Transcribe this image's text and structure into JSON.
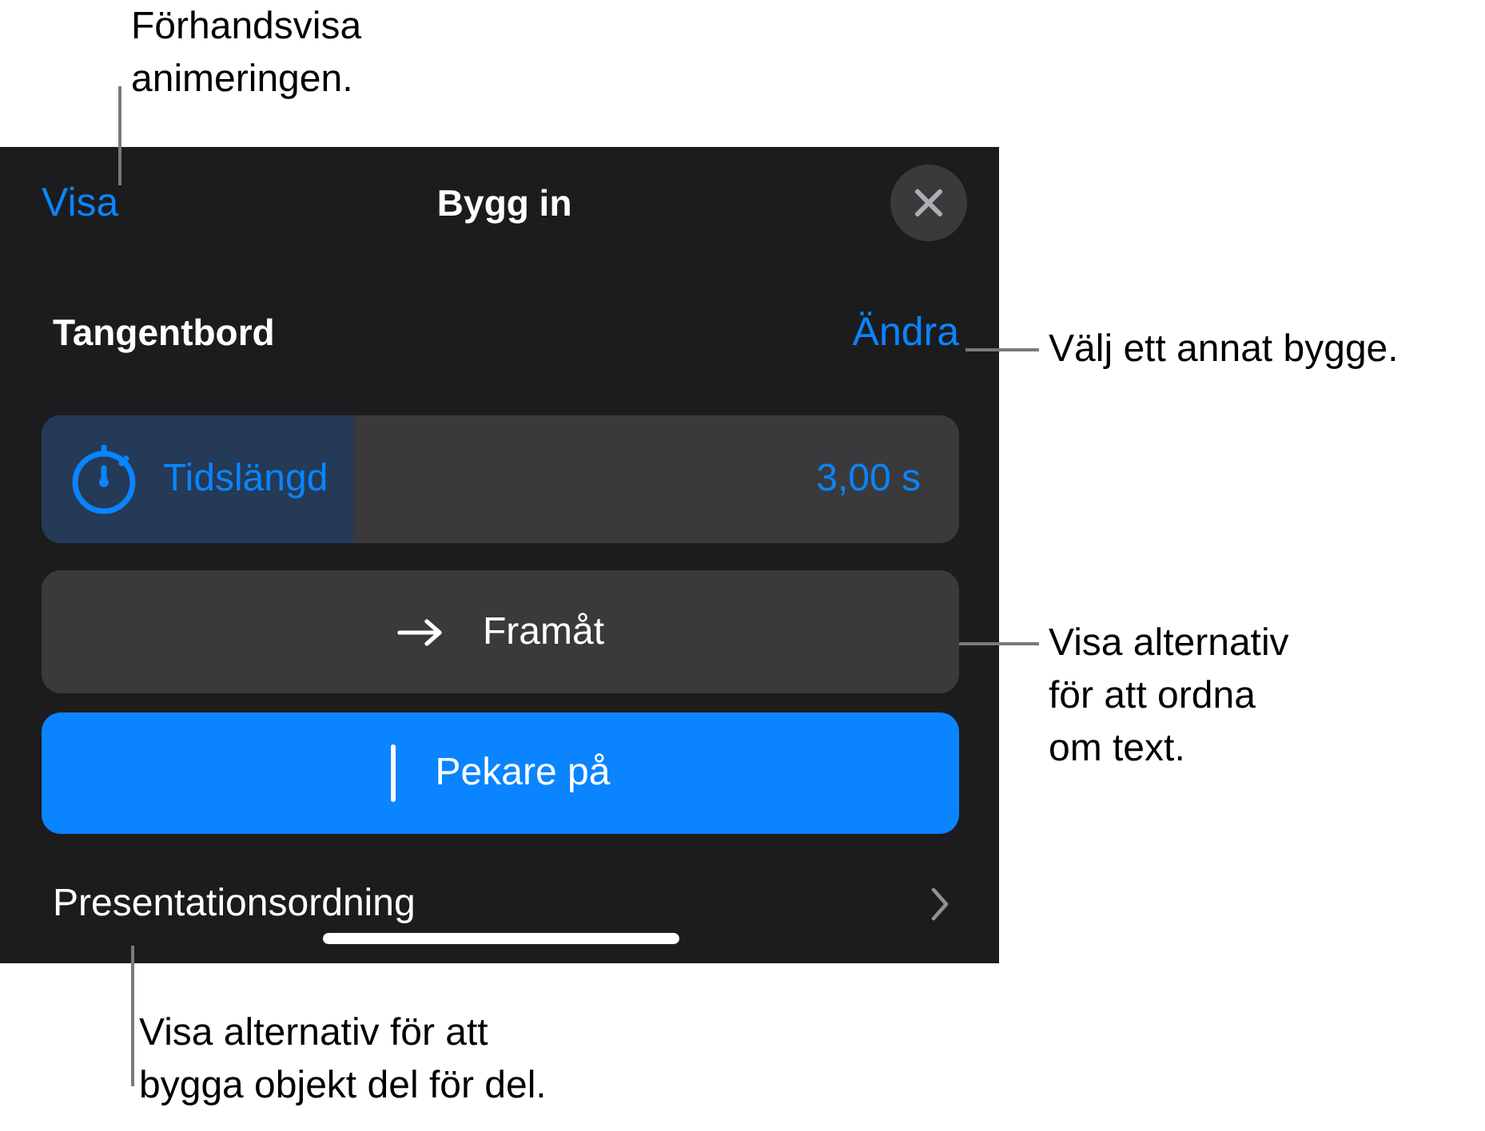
{
  "panel": {
    "preview_link": "Visa",
    "title": "Bygg in",
    "effect": {
      "name": "Tangentbord",
      "change_link": "Ändra"
    },
    "duration": {
      "label": "Tidslängd",
      "value": "3,00 s",
      "level": 0.34
    },
    "buttons": [
      {
        "label": "Framåt",
        "kind": "direction",
        "on": false
      },
      {
        "label": "Pekare på",
        "kind": "cursor",
        "on": true
      }
    ],
    "order_row": {
      "label": "Presentationsordning"
    }
  },
  "callouts": [
    {
      "text": "Förhandsvisa\nanimeringen."
    },
    {
      "text": "Välj ett annat bygge."
    },
    {
      "text": "Visa alternativ\nför att ordna\nom text."
    },
    {
      "text": "Visa alternativ för att\nbygga objekt del för del."
    }
  ]
}
